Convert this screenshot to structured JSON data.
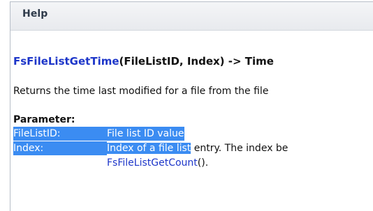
{
  "panel": {
    "title": "Help"
  },
  "help": {
    "function_name": "FsFileListGetTime",
    "signature_rest": "(FileListID, Index) -> Time",
    "description": "Returns the time last modified for a file from the file",
    "parameter_heading": "Parameter:",
    "params": [
      {
        "name": "FileListID:",
        "value_selected": "File list ID value",
        "value_rest": ""
      },
      {
        "name": "Index:",
        "value_selected": "Index of a file list",
        "value_rest": " entry. The index be"
      }
    ],
    "continuation_link": "FsFileListGetCount",
    "continuation_suffix": "()."
  },
  "colors": {
    "selection": "#3b8cf2",
    "function_name": "#1d36c9",
    "text": "#101010"
  }
}
